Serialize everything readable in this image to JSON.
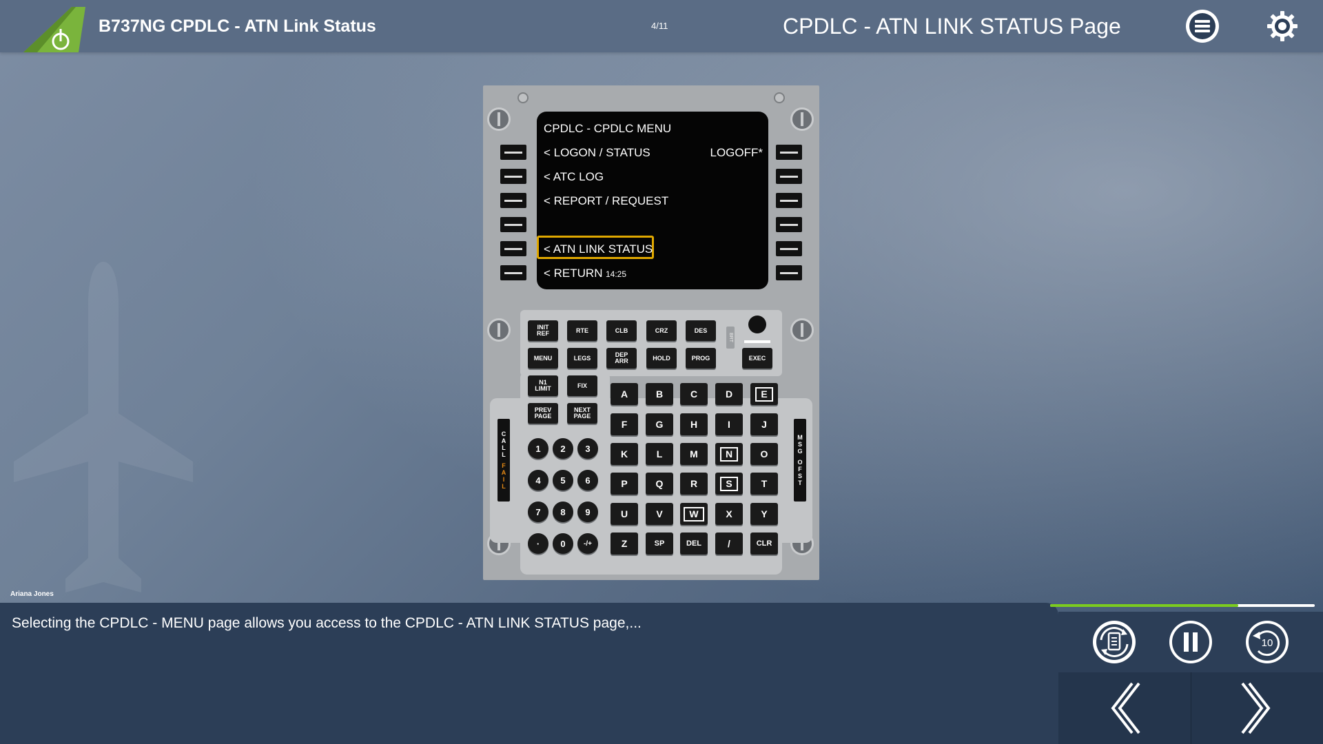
{
  "header": {
    "course_title": "B737NG CPDLC - ATN Link Status",
    "page_count": "4/11",
    "page_title": "CPDLC - ATN LINK STATUS Page",
    "menu_icon": "hamburger-menu-icon",
    "settings_icon": "gear-icon"
  },
  "fmc": {
    "screen": {
      "title": "CPDLC - CPDLC MENU",
      "line1_left": "< LOGON  / STATUS",
      "line1_right": "LOGOFF*",
      "line2_left": "< ATC LOG",
      "line3_left": "< REPORT / REQUEST",
      "line5_left": "< ATN LINK STATUS",
      "line6_left": "< RETURN",
      "time": "14:25"
    },
    "function_keys_row1": [
      "INIT\nREF",
      "RTE",
      "CLB",
      "CRZ",
      "DES"
    ],
    "function_keys_row2": [
      "MENU",
      "LEGS",
      "DEP\nARR",
      "HOLD",
      "PROG"
    ],
    "exec": "EXEC",
    "function_keys_row3": [
      "N1\nLIMIT",
      "FIX"
    ],
    "function_keys_row4": [
      "PREV\nPAGE",
      "NEXT\nPAGE"
    ],
    "brt_label": "BRT",
    "call_label": "CALL",
    "fail_label": "FAIL",
    "msg_label": "MSG",
    "ofst_label": "OFST",
    "alpha_rows": [
      [
        "A",
        "B",
        "C",
        "D",
        "E"
      ],
      [
        "F",
        "G",
        "H",
        "I",
        "J"
      ],
      [
        "K",
        "L",
        "M",
        "N",
        "O"
      ],
      [
        "P",
        "Q",
        "R",
        "S",
        "T"
      ],
      [
        "U",
        "V",
        "W",
        "X",
        "Y"
      ],
      [
        "Z",
        "SP",
        "DEL",
        "/",
        "CLR"
      ]
    ],
    "num_rows": [
      [
        "1",
        "2",
        "3"
      ],
      [
        "4",
        "5",
        "6"
      ],
      [
        "7",
        "8",
        "9"
      ],
      [
        "·",
        "0",
        "-/+"
      ]
    ]
  },
  "narrator": "Ariana Jones",
  "transcript": "Selecting the CPDLC - MENU page allows you access to the CPDLC - ATN LINK STATUS page,...",
  "progress": 0.71,
  "controls": {
    "transcript_icon": "transcript-refresh-icon",
    "pause_icon": "pause-icon",
    "replay_icon": "replay-10-icon",
    "replay_label": "10",
    "prev_icon": "chevron-left-icon",
    "next_icon": "chevron-right-icon"
  },
  "colors": {
    "header_bg": "#5a6c85",
    "panel_bg": "#2c3e57",
    "progress": "#7ccc1e",
    "highlight": "#e0a800",
    "fail": "#e78a14"
  }
}
